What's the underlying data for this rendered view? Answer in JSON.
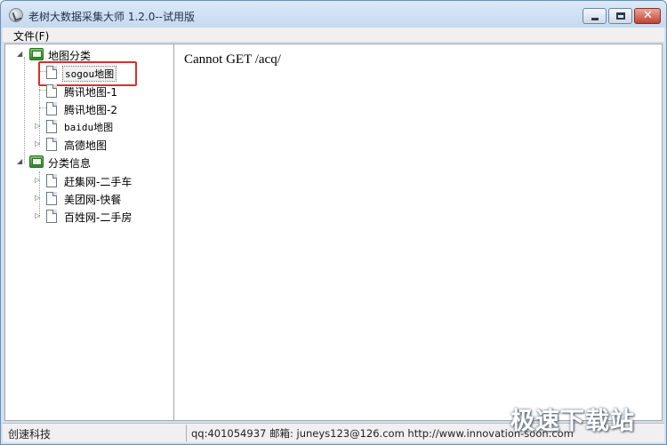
{
  "window": {
    "title": "老树大数据采集大师 1.2.0--试用版",
    "minimize_icon": "minimize-icon",
    "maximize_icon": "maximize-icon",
    "close_icon": "close-icon"
  },
  "menu": {
    "items": [
      {
        "label": "文件(F)"
      }
    ]
  },
  "tree": {
    "groups": [
      {
        "label": "地图分类",
        "icon": "folder-icon",
        "items": [
          {
            "label": "sogou地图",
            "selected": true
          },
          {
            "label": "腾讯地图-1"
          },
          {
            "label": "腾讯地图-2"
          },
          {
            "label": "baidu地图"
          },
          {
            "label": "高德地图"
          }
        ]
      },
      {
        "label": "分类信息",
        "icon": "folder-icon",
        "items": [
          {
            "label": "赶集网-二手车"
          },
          {
            "label": "美团网-快餐"
          },
          {
            "label": "百姓网-二手房"
          }
        ]
      }
    ]
  },
  "main": {
    "message": "Cannot GET /acq/"
  },
  "status": {
    "company": "创速科技",
    "contact": "qq:401054937 邮箱: juneys123@126.com http://www.innovation-soon.com"
  },
  "watermark": {
    "text": "极速下载站"
  },
  "colors": {
    "highlight_box": "#d9302c",
    "title_bar": "#c5d9ef"
  }
}
